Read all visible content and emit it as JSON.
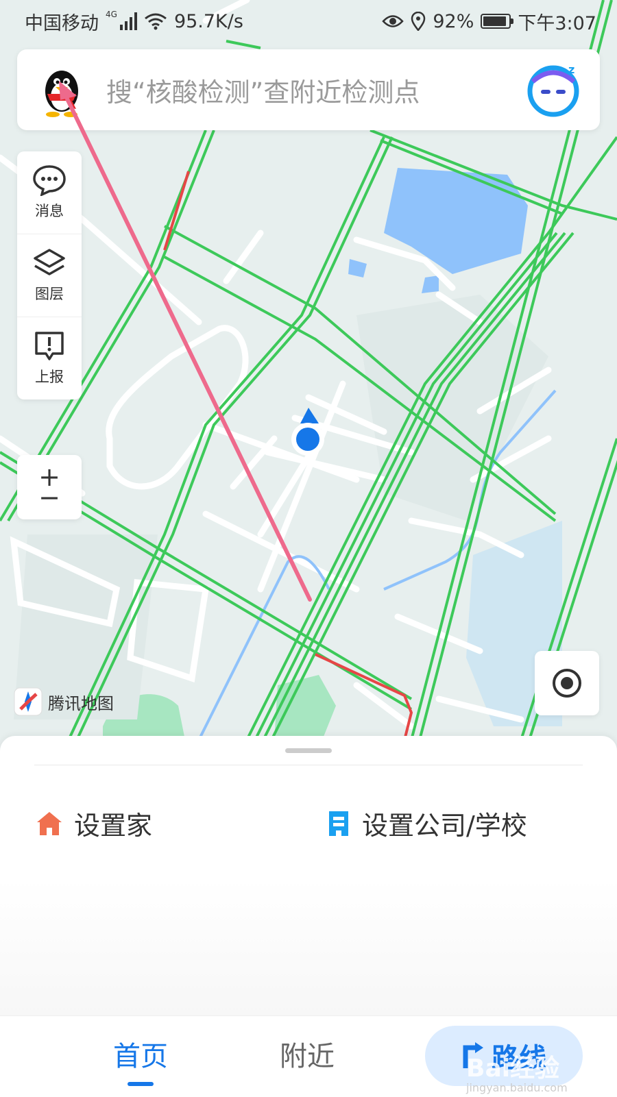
{
  "status_bar": {
    "carrier": "中国移动",
    "network_type": "4G",
    "speed": "95.7K/s",
    "battery": "92%",
    "battery_level": 0.92,
    "time": "下午3:07"
  },
  "search": {
    "placeholder": "搜“核酸检测”查附近检测点",
    "avatar_icon": "qq-penguin-icon",
    "assistant_icon": "assistant-face-icon"
  },
  "side_panel": {
    "items": [
      {
        "label": "消息",
        "icon": "message-bubble-icon"
      },
      {
        "label": "图层",
        "icon": "layers-icon"
      },
      {
        "label": "上报",
        "icon": "report-icon"
      }
    ]
  },
  "zoom": {
    "in": "+",
    "out": "−"
  },
  "map": {
    "logo_text": "腾讯地图",
    "road_color": "#3dc95a",
    "congested_color": "#e64646",
    "water_color": "#8fc2fb",
    "location_color": "#1677e8"
  },
  "bottom_sheet": {
    "home_label": "设置家",
    "work_label": "设置公司/学校",
    "home_icon_color": "#f0704f",
    "work_icon_color": "#1aa0f0"
  },
  "tabs": {
    "home": "首页",
    "nearby": "附近",
    "route": "路线",
    "active_color": "#1677e8"
  },
  "watermark": {
    "text": "Bai经验",
    "sub": "jingyan.baidu.com"
  }
}
